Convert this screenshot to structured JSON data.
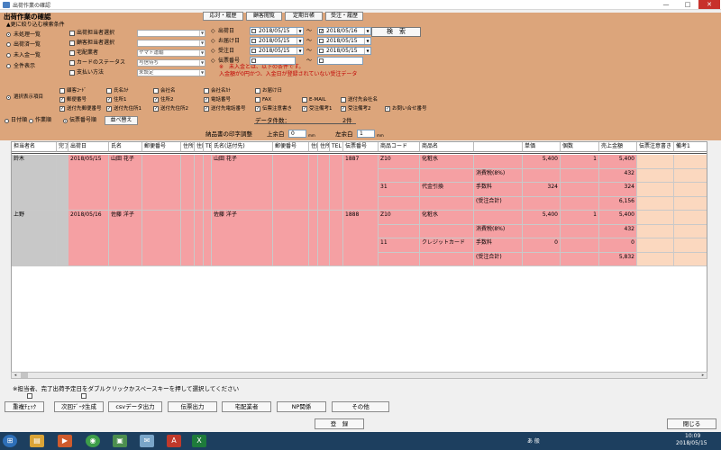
{
  "window": {
    "title": "出荷作業の確認",
    "min": "—",
    "max": "□",
    "close": "✕"
  },
  "top_buttons": [
    "応対・履歴",
    "顧客閲覧",
    "定期台帳",
    "受注・履歴"
  ],
  "panel": {
    "heading": "出荷作業の確認",
    "subheading": "▲更に絞り込む検索条件",
    "radios": [
      {
        "label": "未処理一覧",
        "selected": true
      },
      {
        "label": "出荷済一覧",
        "selected": false
      },
      {
        "label": "未入金一覧",
        "selected": false
      },
      {
        "label": "全件表示",
        "selected": false
      }
    ],
    "filters": [
      {
        "label": "出荷担当者選択",
        "value": ""
      },
      {
        "label": "顧客担当者選択",
        "value": ""
      },
      {
        "label": "宅配業者",
        "value": "ヤマト運輸"
      },
      {
        "label": "カードのステータス",
        "value": "与信待ち"
      },
      {
        "label": "支払い方法",
        "value": "未設定"
      }
    ],
    "dates": [
      {
        "label": "出荷日",
        "from": "2018/05/15",
        "to": "2018/05/16",
        "from_checked": false,
        "to_checked": true
      },
      {
        "label": "お届け日",
        "from": "2018/05/15",
        "to": "2018/05/15",
        "from_checked": false,
        "to_checked": false
      },
      {
        "label": "受注日",
        "from": "2018/05/15",
        "to": "2018/05/15",
        "from_checked": false,
        "to_checked": false
      },
      {
        "label": "伝票番号",
        "from": "",
        "to": "",
        "from_checked": false,
        "to_checked": false
      }
    ],
    "tilde": "～",
    "search_button": "検　索",
    "notes": [
      "※　未入金とは、以下の条件です。",
      "入金額が0円かつ、入金日が登録されていない受注データ"
    ],
    "display_items_label": "選択表示項目",
    "display_items": [
      {
        "label": "顧客ｺｰﾄﾞ",
        "checked": false
      },
      {
        "label": "氏名ｶﾅ",
        "checked": false
      },
      {
        "label": "会社名",
        "checked": false
      },
      {
        "label": "会社名ｶﾅ",
        "checked": false
      },
      {
        "label": "お届け日",
        "checked": false
      },
      {
        "label": "郵便番号",
        "checked": true
      },
      {
        "label": "住所1",
        "checked": true
      },
      {
        "label": "住所2",
        "checked": true
      },
      {
        "label": "電話番号",
        "checked": true
      },
      {
        "label": "FAX",
        "checked": false
      },
      {
        "label": "E-MAIL",
        "checked": false
      },
      {
        "label": "送付先会社名",
        "checked": false
      },
      {
        "label": "送付先郵便番号",
        "checked": true
      },
      {
        "label": "送付先住所1",
        "checked": true
      },
      {
        "label": "送付先住所2",
        "checked": true
      },
      {
        "label": "送付先電話番号",
        "checked": true
      },
      {
        "label": "伝票注意書き",
        "checked": true
      },
      {
        "label": "受注備考1",
        "checked": true
      },
      {
        "label": "受注備考2",
        "checked": true
      },
      {
        "label": "お問い合せ番号",
        "checked": true
      }
    ]
  },
  "sort": {
    "options": [
      {
        "label": "日付順",
        "selected": false
      },
      {
        "label": "作業順",
        "selected": false
      },
      {
        "label": "伝票番号順",
        "selected": true
      }
    ],
    "button": "並べ替え",
    "count_label": "データ件数：",
    "count_value": "2件"
  },
  "print_adjust": {
    "title": "納品書の印字調整",
    "top_label": "上余白",
    "top_value": "0",
    "top_unit": "mm",
    "left_label": "左余白",
    "left_value": "1",
    "left_unit": "mm"
  },
  "table": {
    "headers": [
      "担当者名",
      "完了",
      "出荷日",
      "氏名",
      "郵便番号",
      "住所",
      "住所",
      "TE",
      "氏名(送付先)",
      "郵便番号",
      "住所",
      "住所",
      "TEL",
      "伝票番号",
      "商品コード",
      "商品名",
      "",
      "単価",
      "個数",
      "売上金額",
      "伝票注意書き",
      "備考1"
    ],
    "orders": [
      {
        "staff": "鈴木",
        "date": "2018/05/15",
        "name": "山田 花子",
        "ship_name": "山田 花子",
        "slip": "1887",
        "lines": [
          {
            "code": "Z10",
            "product": "化粧水",
            "label": "",
            "price": "5,400",
            "qty": "1",
            "amount": "5,400"
          },
          {
            "code": "",
            "product": "",
            "label": "消費税(8%)",
            "price": "",
            "qty": "",
            "amount": "432"
          },
          {
            "code": "31",
            "product": "代金引換",
            "label": "手数料",
            "price": "324",
            "qty": "",
            "amount": "324"
          },
          {
            "code": "",
            "product": "",
            "label": "(受注合計)",
            "price": "",
            "qty": "",
            "amount": "6,156"
          }
        ]
      },
      {
        "staff": "上野",
        "date": "2018/05/16",
        "name": "佐藤 洋子",
        "ship_name": "佐藤 洋子",
        "slip": "1888",
        "lines": [
          {
            "code": "Z10",
            "product": "化粧水",
            "label": "",
            "price": "5,400",
            "qty": "1",
            "amount": "5,400"
          },
          {
            "code": "",
            "product": "",
            "label": "消費税(8%)",
            "price": "",
            "qty": "",
            "amount": "432"
          },
          {
            "code": "11",
            "product": "クレジットカード",
            "label": "手数料",
            "price": "0",
            "qty": "",
            "amount": "0"
          },
          {
            "code": "",
            "product": "",
            "label": "(受注合計)",
            "price": "",
            "qty": "",
            "amount": "5,832"
          }
        ]
      }
    ]
  },
  "footnote": "※担当者、完了出荷予定日をダブルクリックかスペースキーを押して選択してください",
  "bottom_buttons": [
    "重複ﾁｪｯｸ",
    "次回ﾃﾞｰﾀ生成",
    "csvデータ出力",
    "伝票出力",
    "宅配業者",
    "NP関係",
    "その他"
  ],
  "register_button": "登　録",
  "close_button": "閉じる",
  "taskbar": {
    "time": "10:09",
    "date": "2018/05/15",
    "ime": "あ 般"
  }
}
